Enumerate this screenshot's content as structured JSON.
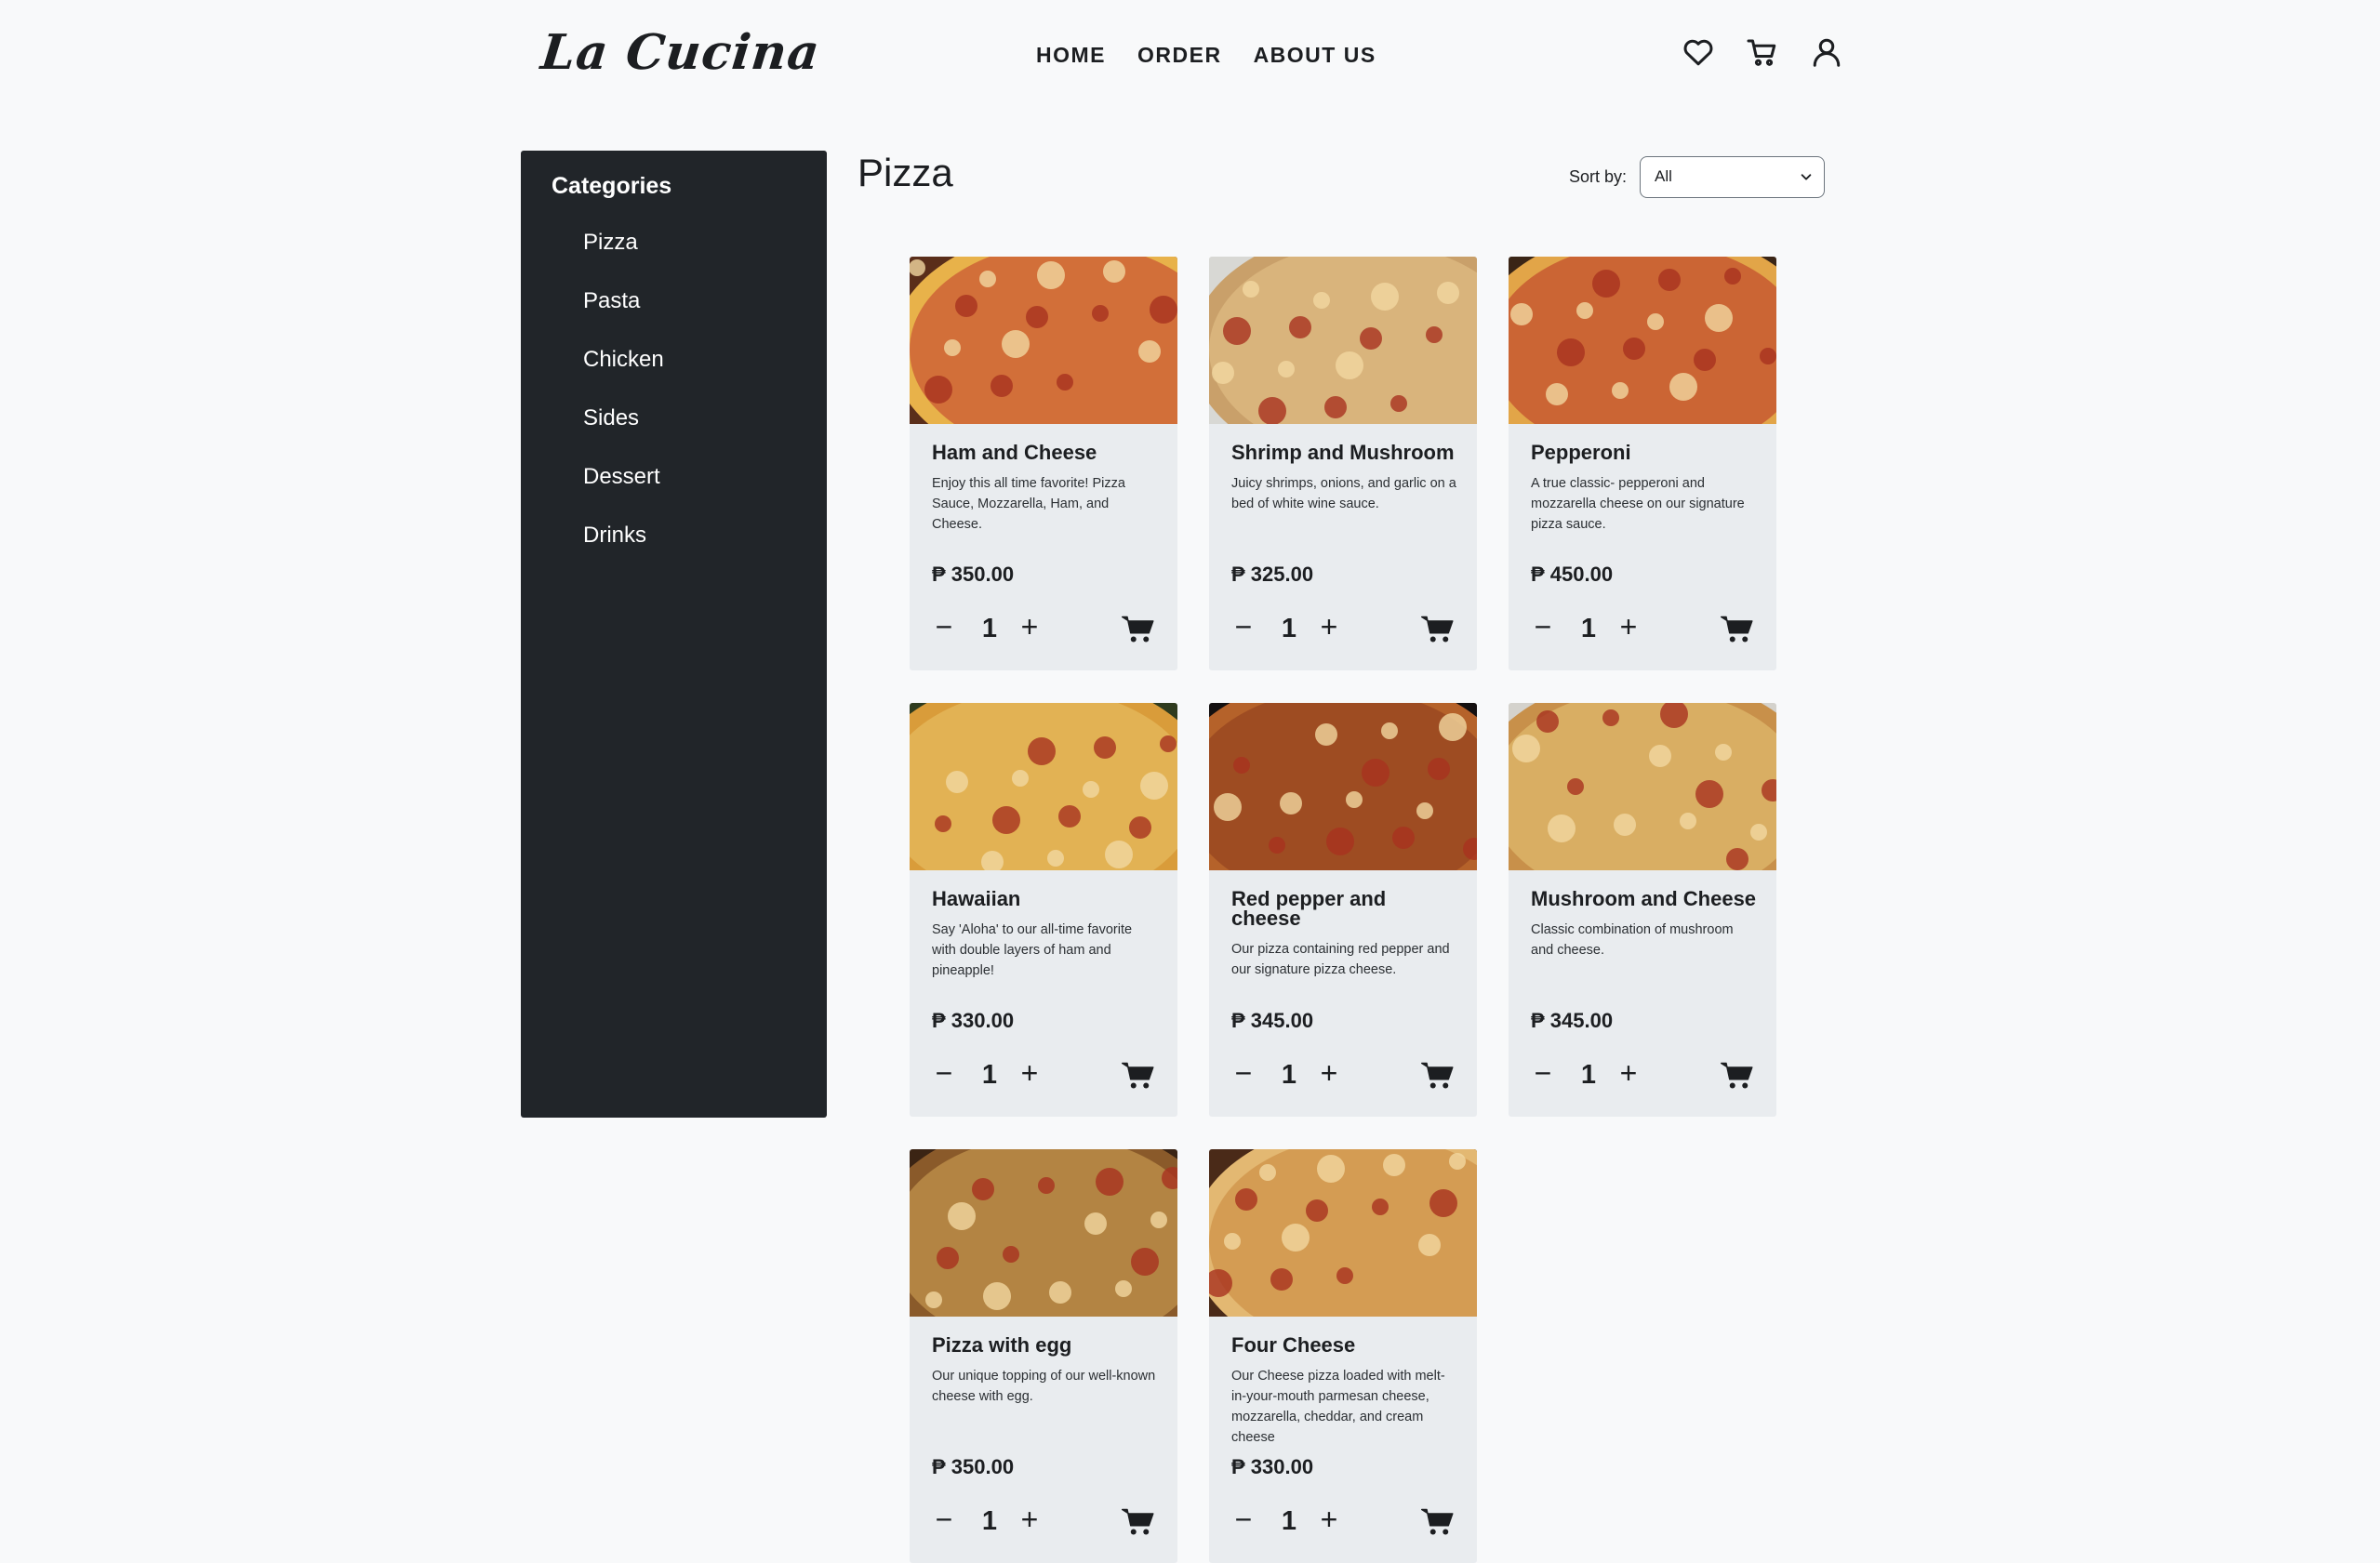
{
  "brand": {
    "name": "La Cucina"
  },
  "nav": [
    {
      "label": "HOME"
    },
    {
      "label": "ORDER"
    },
    {
      "label": "ABOUT US"
    }
  ],
  "header_icons": [
    "heart-icon",
    "cart-icon",
    "user-icon"
  ],
  "sidebar": {
    "title": "Categories",
    "items": [
      {
        "label": "Pizza"
      },
      {
        "label": "Pasta"
      },
      {
        "label": "Chicken"
      },
      {
        "label": "Sides"
      },
      {
        "label": "Dessert"
      },
      {
        "label": "Drinks"
      }
    ]
  },
  "main": {
    "title": "Pizza",
    "sort": {
      "label": "Sort by:",
      "value": "All"
    }
  },
  "products": [
    {
      "name": "Ham and Cheese",
      "description": "Enjoy this all time favorite! Pizza Sauce, Mozzarella, Ham, and Cheese.",
      "price": "₱ 350.00",
      "qty": "1"
    },
    {
      "name": "Shrimp and Mushroom",
      "description": "Juicy shrimps, onions, and garlic on a bed of white wine sauce.",
      "price": "₱ 325.00",
      "qty": "1"
    },
    {
      "name": "Pepperoni",
      "description": "A true classic- pepperoni and mozzarella cheese on our signature pizza sauce.",
      "price": "₱ 450.00",
      "qty": "1"
    },
    {
      "name": "Hawaiian",
      "description": "Say 'Aloha' to our all-time favorite with double layers of ham and pineapple!",
      "price": "₱ 330.00",
      "qty": "1"
    },
    {
      "name": "Red pepper and cheese",
      "description": "Our pizza containing red pepper and our signature pizza cheese.",
      "price": "₱ 345.00",
      "qty": "1"
    },
    {
      "name": "Mushroom and Cheese",
      "description": "Classic combination of mushroom and cheese.",
      "price": "₱ 345.00",
      "qty": "1"
    },
    {
      "name": "Pizza with egg",
      "description": "Our unique topping of our well-known cheese with egg.",
      "price": "₱ 350.00",
      "qty": "1"
    },
    {
      "name": "Four Cheese",
      "description": "Our Cheese pizza loaded with melt-in-your-mouth parmesan cheese, mozzarella, cheddar, and cream cheese",
      "price": "₱ 330.00",
      "qty": "1"
    }
  ],
  "colors": {
    "sidebar": "#212529",
    "card": "#e9ecef",
    "background": "#f8f9fa",
    "crust": "#d9a04e",
    "sauce": "#c0392b"
  }
}
